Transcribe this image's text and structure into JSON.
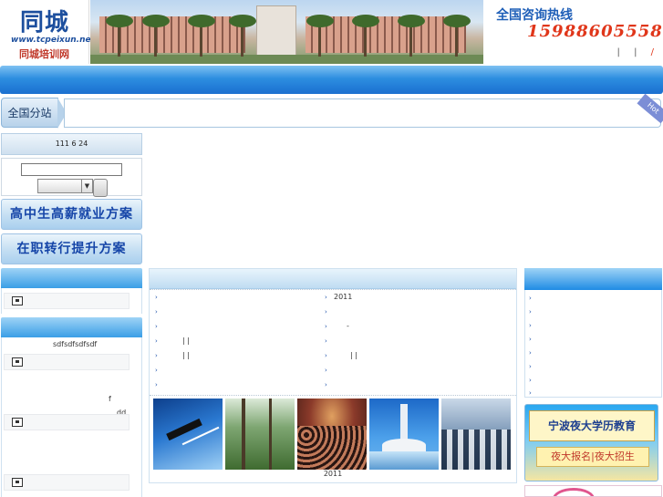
{
  "header": {
    "logo_big": "同城",
    "logo_url": "www.tcpeixun.net",
    "logo_cn": "同城培训网",
    "hotline_label": "全国咨询热线",
    "hotline_phone": "15988605558",
    "top_links": [
      "|",
      "|",
      "/"
    ]
  },
  "stations": {
    "tab_label": "全国分站",
    "hot_badge": "Hot"
  },
  "left": {
    "date_text": "111 6 24",
    "search_placeholder": "",
    "promo_1": "高中生高薪就业方案",
    "promo_2": "在职转行提升方案",
    "panel2_text": "sdfsdfsdfsdf",
    "panel2_f": "f",
    "panel2_dd": "dd"
  },
  "center": {
    "left_items": [
      "",
      "",
      "",
      "| |",
      "| |",
      "",
      ""
    ],
    "right_items": [
      "2011",
      "",
      "-",
      "",
      "| |",
      "",
      ""
    ],
    "photo_caption": "2011"
  },
  "right": {
    "items_count": 8,
    "ad1_title": "宁波夜大学历教育",
    "ad1_links": "夜大报名|夜大招生"
  },
  "colors": {
    "nav_blue": "#1a6fd0",
    "hotline_red": "#e0361a",
    "promo_text": "#1545a8"
  }
}
